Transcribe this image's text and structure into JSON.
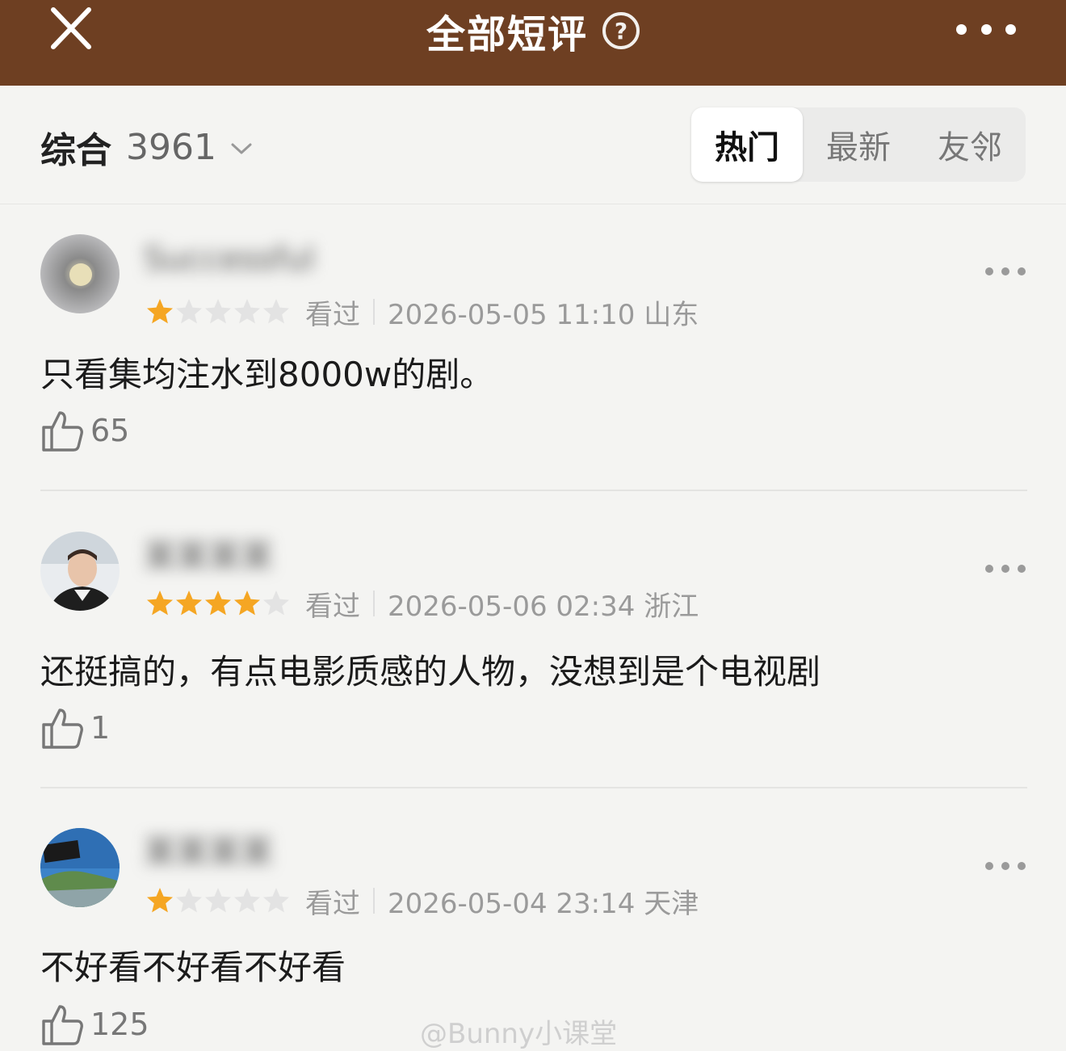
{
  "header": {
    "title": "全部短评",
    "help_glyph": "?"
  },
  "filter": {
    "sort_label": "综合",
    "count": "3961",
    "tabs": [
      {
        "label": "热门",
        "active": true
      },
      {
        "label": "最新",
        "active": false
      },
      {
        "label": "友邻",
        "active": false
      }
    ]
  },
  "colors": {
    "header_bg": "#6e3f22",
    "star_on": "#f5a623",
    "star_off": "#e3e3e3"
  },
  "reviews": [
    {
      "username": "Successful",
      "rating": 1,
      "status": "看过",
      "datetime": "2026-05-05 11:10 山东",
      "content": "只看集均注水到8000w的剧。",
      "likes": "65"
    },
    {
      "username": "某某某某",
      "rating": 4,
      "status": "看过",
      "datetime": "2026-05-06 02:34 浙江",
      "content": "还挺搞的，有点电影质感的人物，没想到是个电视剧",
      "likes": "1"
    },
    {
      "username": "某某某某",
      "rating": 1,
      "status": "看过",
      "datetime": "2026-05-04 23:14 天津",
      "content": "不好看不好看不好看",
      "likes": "125"
    }
  ],
  "watermark": "@Bunny小课堂"
}
